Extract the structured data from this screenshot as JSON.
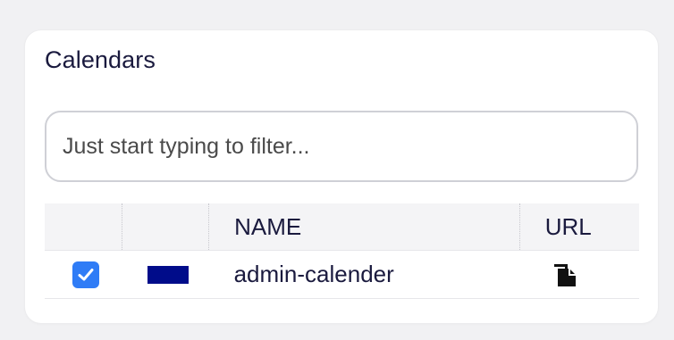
{
  "panel": {
    "title": "Calendars"
  },
  "filter": {
    "placeholder": "Just start typing to filter..."
  },
  "table": {
    "headers": {
      "name": "NAME",
      "url": "URL"
    },
    "rows": [
      {
        "checked": true,
        "color": "#000c8a",
        "name": "admin-calender",
        "url_icon": "copy-icon"
      }
    ]
  },
  "colors": {
    "checkbox_accent": "#2f7cf6",
    "text": "#1a1a3e"
  }
}
